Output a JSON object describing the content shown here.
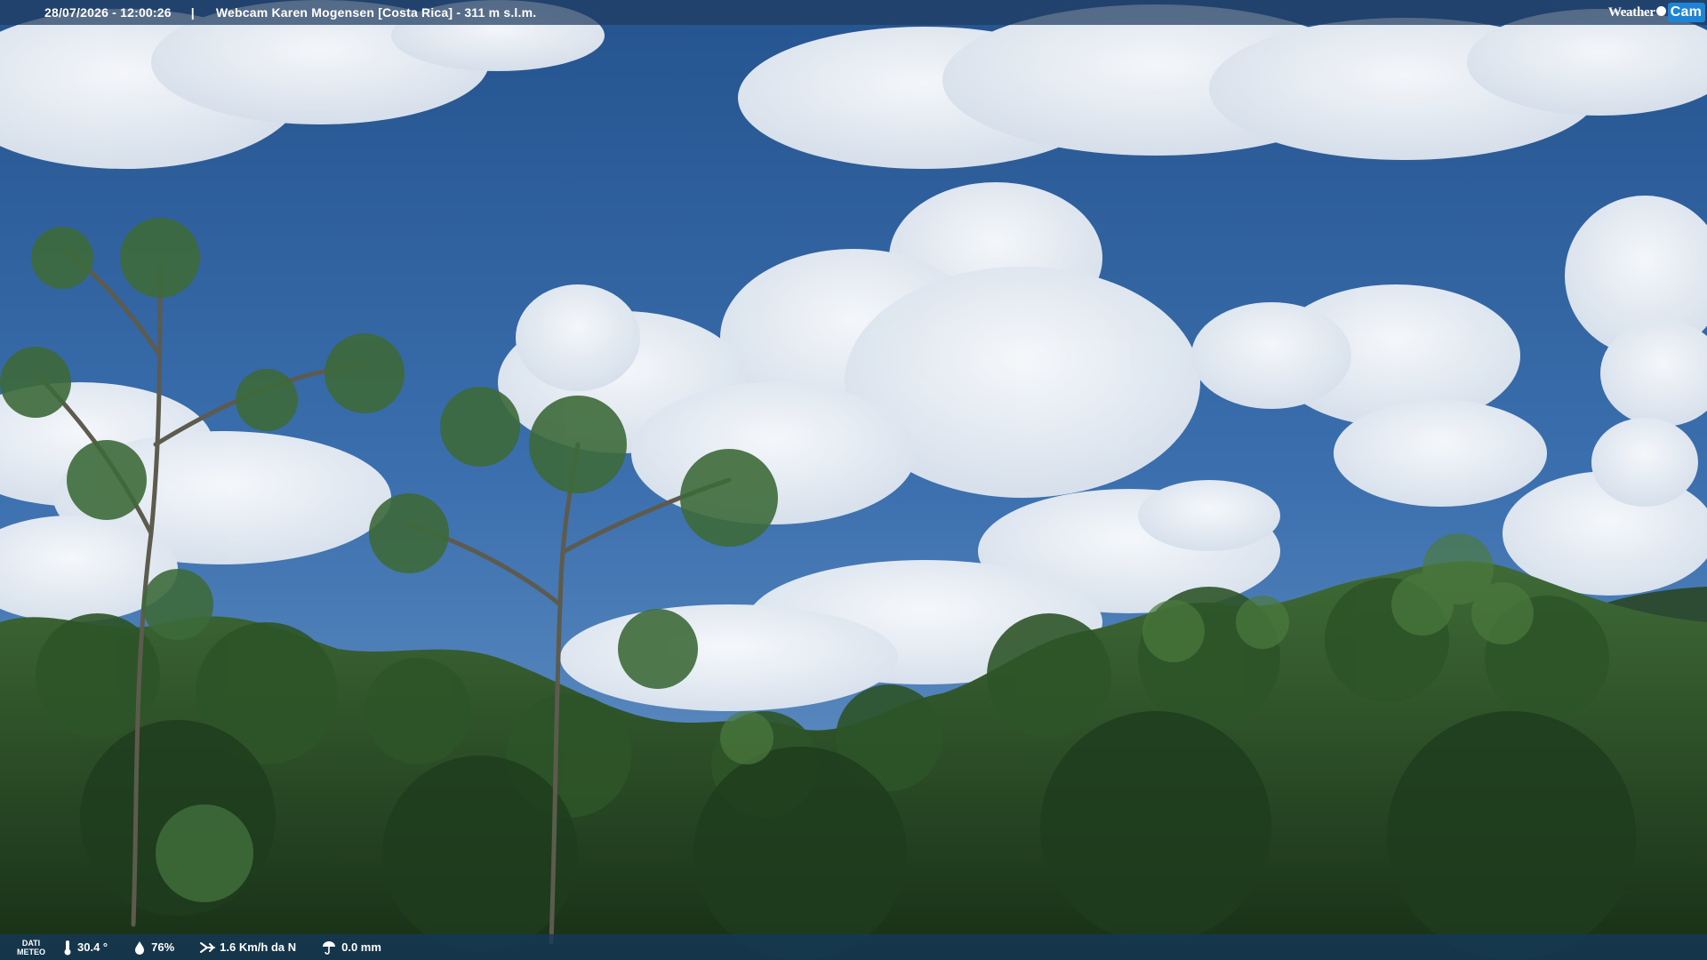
{
  "header": {
    "datetime": "28/07/2026 - 12:00:26",
    "separator": "|",
    "title": "Webcam Karen Mogensen [Costa Rica]  - 311 m s.l.m."
  },
  "logo": {
    "weather": "Weather",
    "cam": "Cam"
  },
  "footer": {
    "dati_line1": "DATI",
    "dati_line2": "METEO",
    "temperature": "30.4 °",
    "humidity": "76%",
    "wind": "1.6 Km/h da N",
    "rain": "0.0 mm"
  },
  "icons": {
    "temperature": "thermometer-icon",
    "humidity": "droplet-icon",
    "wind": "wind-icon",
    "rain": "rain-icon"
  }
}
